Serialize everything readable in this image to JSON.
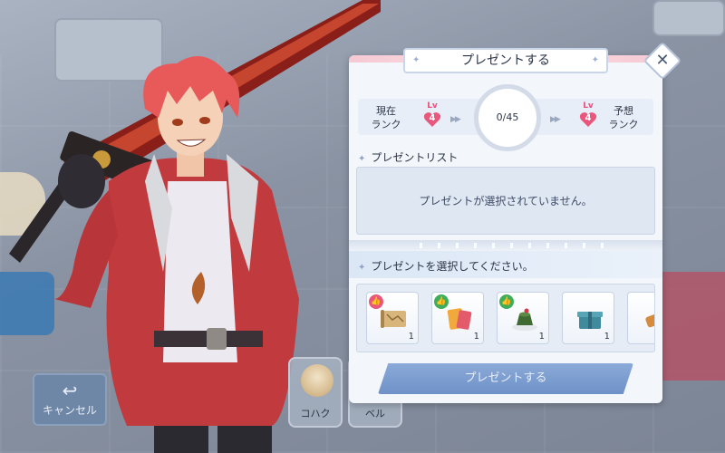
{
  "panel": {
    "title": "プレゼントする",
    "close_symbol": "✕",
    "current_rank": {
      "label_line1": "現在",
      "label_line2": "ランク",
      "lv": "Lv",
      "value": "4"
    },
    "expected_rank": {
      "label_line1": "予想",
      "label_line2": "ランク",
      "lv": "Lv",
      "value": "4"
    },
    "progress_text": "0/45",
    "present_list_title": "プレゼントリスト",
    "empty_message": "プレゼントが選択されていません。",
    "select_prompt": "プレゼントを選択してください。",
    "items": [
      {
        "icon": "scroll-map-icon",
        "badge": "thumbs-up",
        "badge_color": "#e9577c",
        "qty": "1"
      },
      {
        "icon": "tickets-icon",
        "badge": "thumbs-up",
        "badge_color": "#3fae5a",
        "qty": "1"
      },
      {
        "icon": "pudding-icon",
        "badge": "thumbs-up",
        "badge_color": "#3fae5a",
        "qty": "1"
      },
      {
        "icon": "gift-box-icon",
        "badge": "",
        "badge_color": "",
        "qty": "1"
      },
      {
        "icon": "item-partial-icon",
        "badge": "",
        "badge_color": "",
        "qty": ""
      }
    ],
    "present_button": "プレゼントする"
  },
  "bottom": {
    "cancel_label": "キャンセル",
    "slots": [
      {
        "name": "コハク"
      },
      {
        "name": "ベル"
      }
    ]
  },
  "colors": {
    "accent_pink": "#e4507a",
    "button_blue": "#6f91c7",
    "panel_bg": "#f3f6fb"
  }
}
